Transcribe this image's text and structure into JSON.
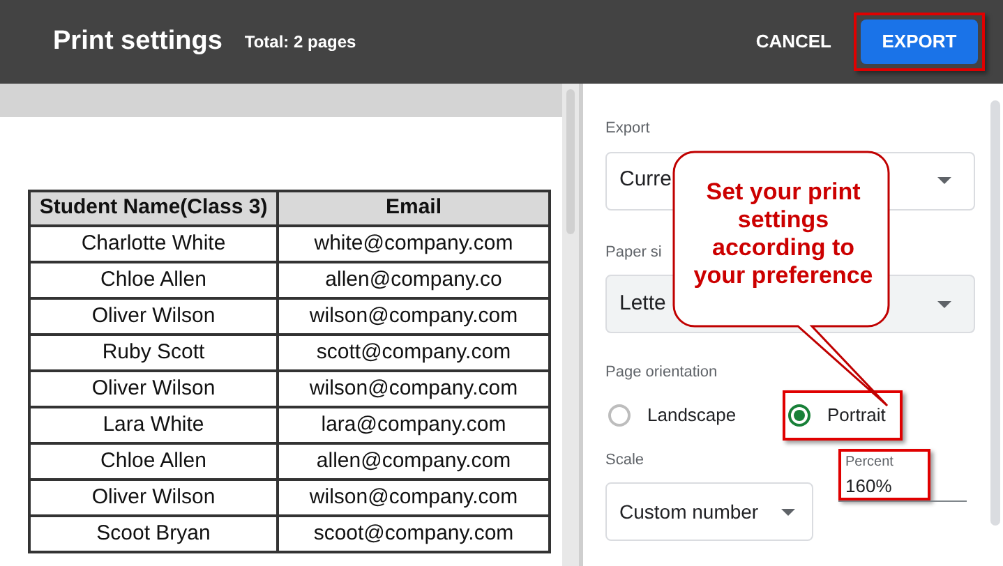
{
  "header": {
    "title": "Print settings",
    "total": "Total: 2 pages",
    "cancel": "CANCEL",
    "export": {
      "label": "EXPORT",
      "highlighted": true
    }
  },
  "table": {
    "columns": [
      "Student Name(Class 3)",
      "Email"
    ],
    "rows": [
      [
        "Charlotte White",
        "white@company.com"
      ],
      [
        "Chloe Allen",
        "allen@company.co"
      ],
      [
        "Oliver Wilson",
        "wilson@company.com"
      ],
      [
        "Ruby Scott",
        "scott@company.com"
      ],
      [
        "Oliver Wilson",
        "wilson@company.com"
      ],
      [
        "Lara White",
        "lara@company.com"
      ],
      [
        "Chloe Allen",
        "allen@company.com"
      ],
      [
        "Oliver Wilson",
        "wilson@company.com"
      ],
      [
        "Scoot Bryan",
        "scoot@company.com"
      ]
    ]
  },
  "settings": {
    "export": {
      "label": "Export",
      "value": "Curre"
    },
    "paper_size": {
      "label": "Paper si",
      "value": "Lette"
    },
    "orientation": {
      "label": "Page orientation",
      "options": [
        {
          "label": "Landscape",
          "selected": false,
          "highlighted": false
        },
        {
          "label": "Portrait",
          "selected": true,
          "highlighted": true
        }
      ]
    },
    "scale": {
      "label": "Scale",
      "value": "Custom number"
    },
    "percent": {
      "label": "Percent",
      "value": "160%",
      "highlighted": true
    }
  },
  "callout": {
    "text": "Set your print settings according to your preference"
  }
}
